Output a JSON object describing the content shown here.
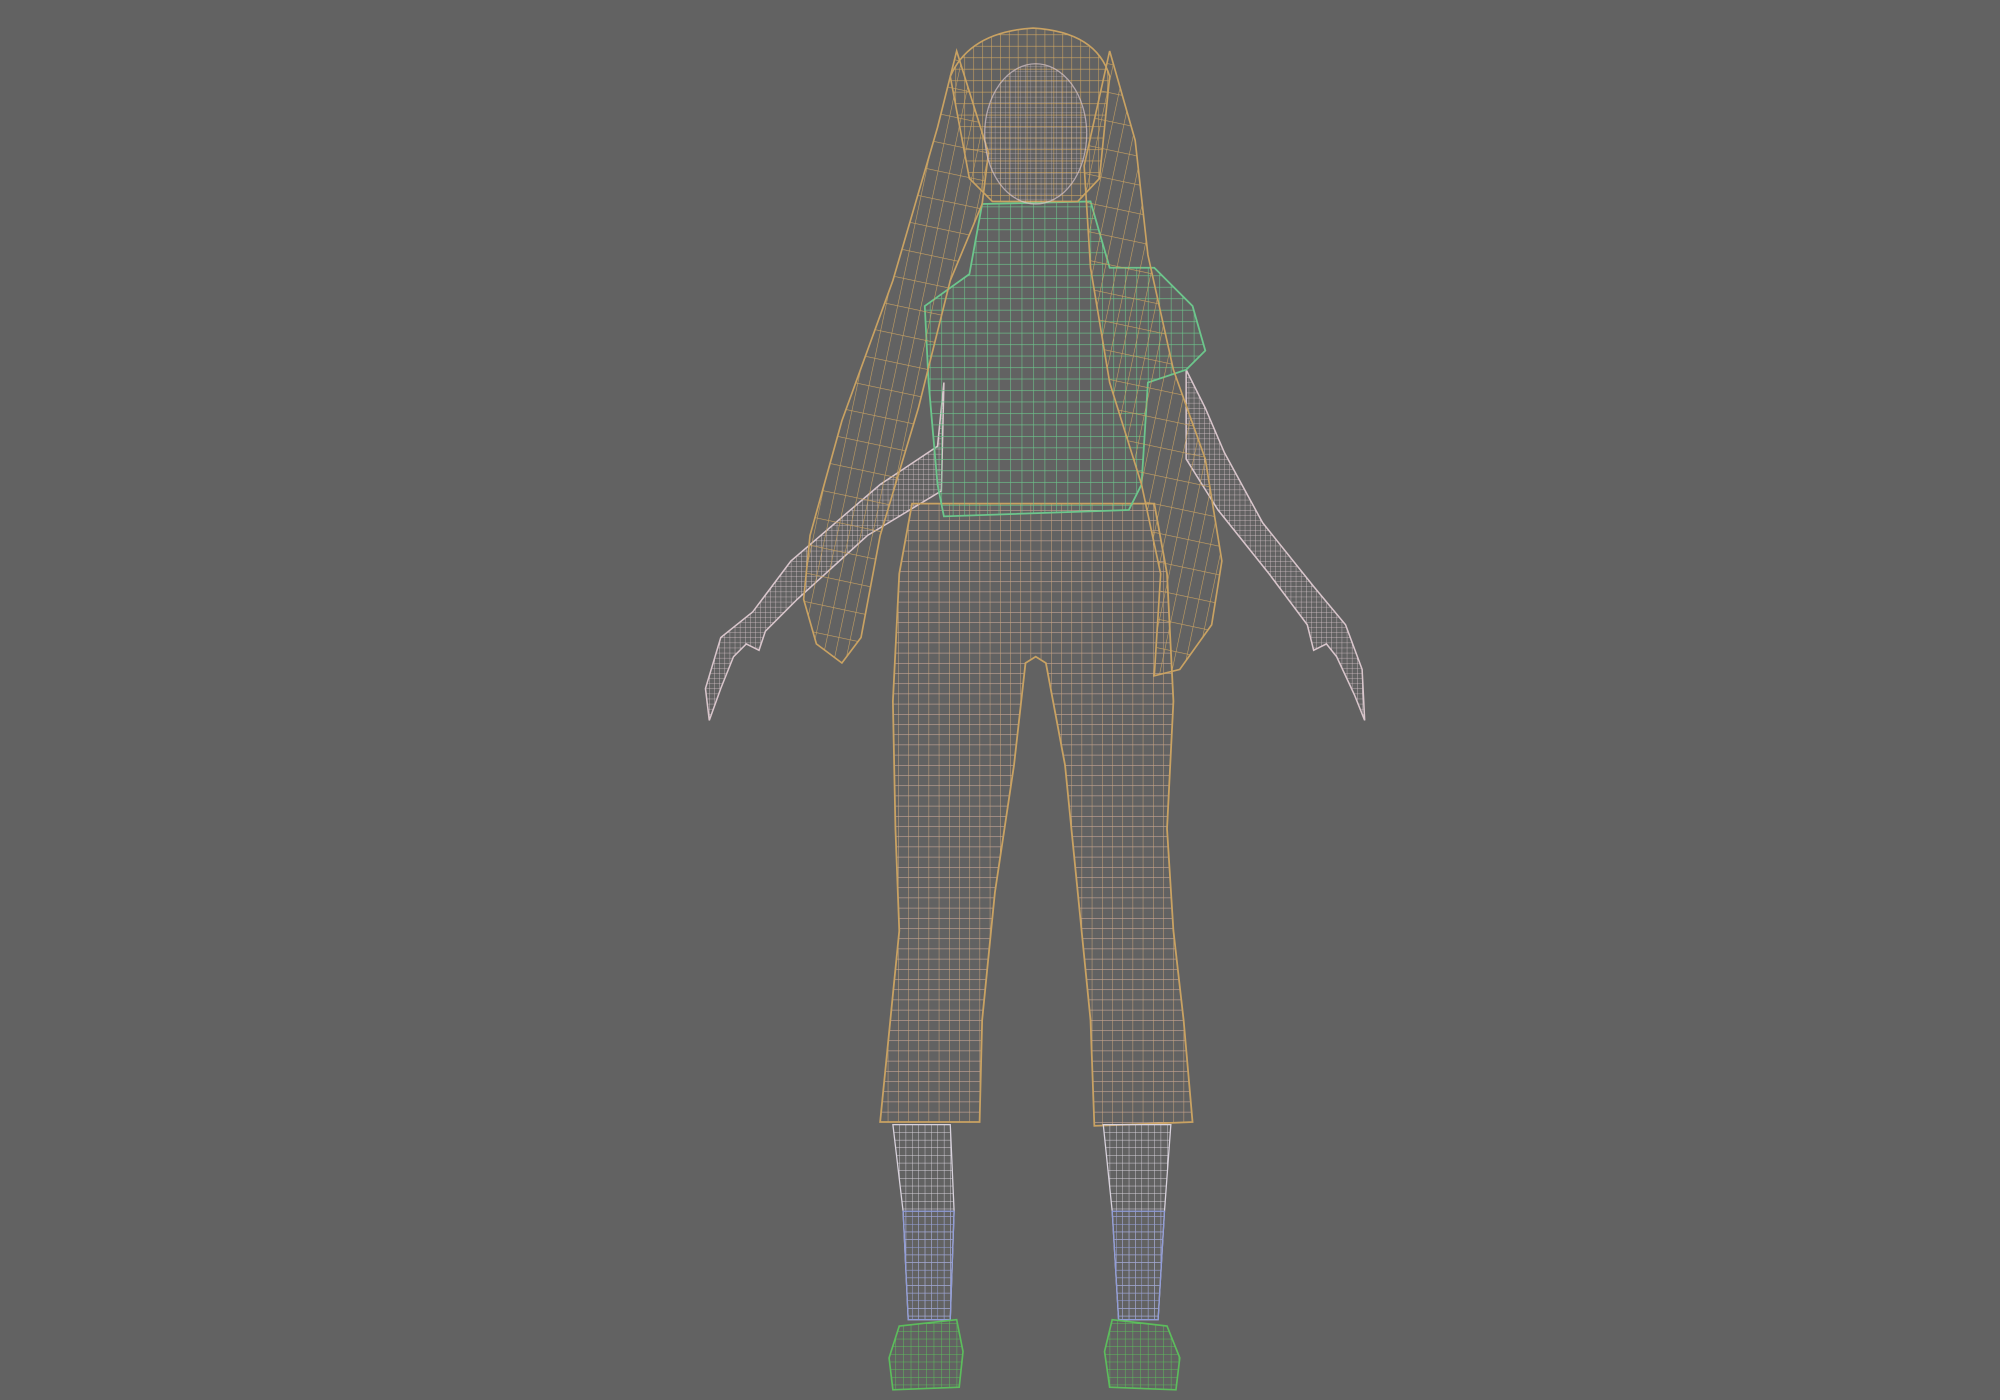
{
  "viewport": {
    "view": "back",
    "render_mode": "wireframe"
  },
  "colors": {
    "background": "#626262",
    "hair": "#c9a262",
    "skin": "#d9c6cc",
    "pants": "#d4b49a",
    "shirt": "#6cc68c",
    "socks_upper": "#d8d2dc",
    "socks_lower": "#8f9bd8",
    "shoes": "#5cbd5c"
  }
}
